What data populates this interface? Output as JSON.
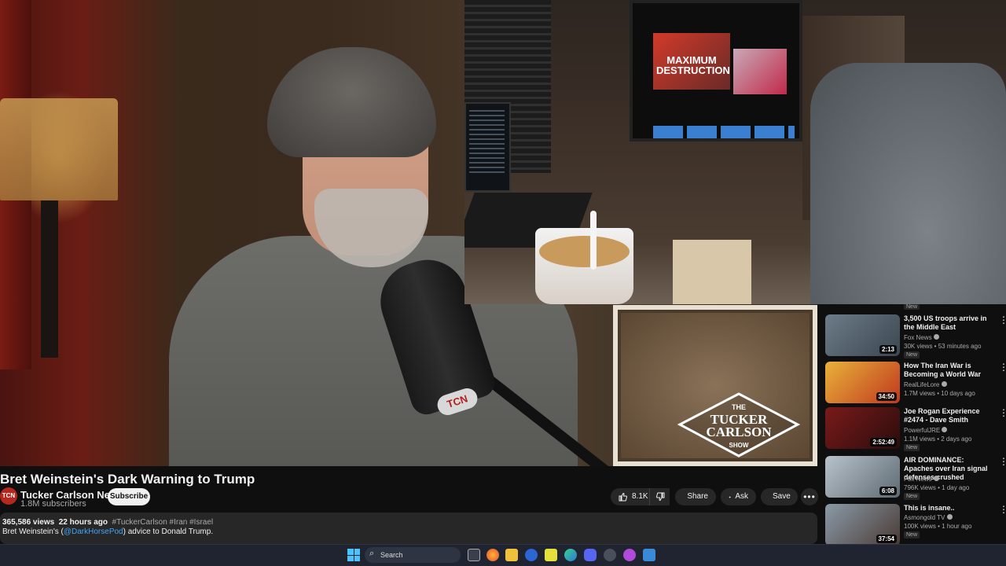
{
  "video": {
    "inset_tv": {
      "thumb_headline": "MAXIMUM DESTRUCTION"
    },
    "mic_badge": "TCN",
    "watermark": {
      "line1": "THE",
      "line2": "TUCKER",
      "line3": "CARLSON",
      "line4": "SHOW"
    }
  },
  "title": "Bret Weinstein's Dark Warning to Trump",
  "channel": {
    "avatar": "TCN",
    "name": "Tucker Carlson Network",
    "subscribers": "1.8M subscribers",
    "subscribe_label": "Subscribe"
  },
  "actions": {
    "likes": "8.1K",
    "share": "Share",
    "ask": "Ask",
    "save": "Save"
  },
  "description": {
    "views": "365,586 views",
    "age": "22 hours ago",
    "tags": "#TuckerCarlson #Iran #Israel",
    "text_before": "Bret Weinstein's (",
    "mention": "@DarkHorsePod",
    "text_after": ") advice to Donald Trump."
  },
  "sidebar": {
    "top_badge": "New",
    "items": [
      {
        "title": "3,500 US troops arrive in the Middle East",
        "channel": "Fox News",
        "meta": "30K views • 53 minutes ago",
        "badge": "New",
        "duration": "2:13",
        "thumb_colors": [
          "#6c7c88",
          "#3b4650"
        ]
      },
      {
        "title": "How The Iran War is Becoming a World War",
        "channel": "RealLifeLore",
        "meta": "1.7M views • 10 days ago",
        "badge": "",
        "duration": "34:50",
        "thumb_colors": [
          "#e9b23a",
          "#c0381e"
        ]
      },
      {
        "title": "Joe Rogan Experience #2474 - Dave Smith",
        "channel": "PowerfulJRE",
        "meta": "1.1M views • 2 days ago",
        "badge": "New",
        "duration": "2:52:49",
        "thumb_colors": [
          "#7a1a1a",
          "#2a0c0c"
        ]
      },
      {
        "title": "AIR DOMINANCE: Apaches over Iran signal defenses crushed",
        "channel": "Fox News",
        "meta": "796K views • 1 day ago",
        "badge": "New",
        "duration": "6:08",
        "thumb_colors": [
          "#b8c2ca",
          "#5e6a72"
        ]
      },
      {
        "title": "This is insane..",
        "channel": "Asmongold TV",
        "meta": "100K views • 1 hour ago",
        "badge": "New",
        "duration": "37:54",
        "thumb_colors": [
          "#8a9aa8",
          "#4a3a34"
        ]
      }
    ]
  },
  "taskbar": {
    "search_placeholder": "Search"
  }
}
